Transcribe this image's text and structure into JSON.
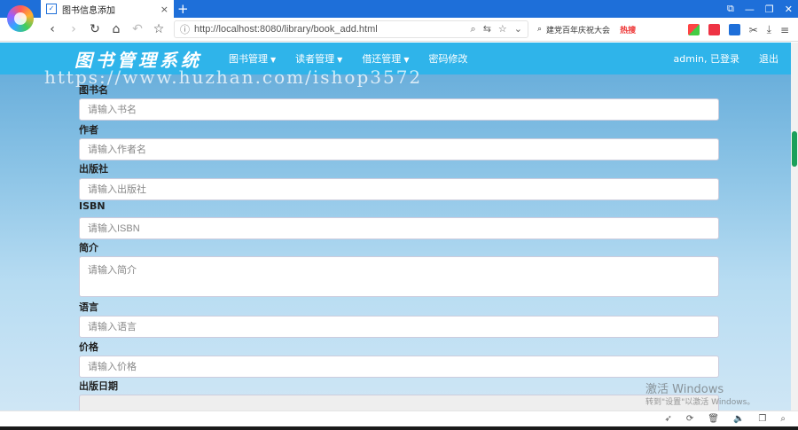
{
  "browser": {
    "tab_title": "图书信息添加",
    "tab_close": "×",
    "new_tab": "+",
    "url": "http://localhost:8080/library/book_add.html",
    "search_text": "建党百年庆祝大会",
    "hot_label": "热搜",
    "window_controls": [
      "⧉",
      "—",
      "❐",
      "✕"
    ]
  },
  "navbar": {
    "brand": "图书管理系统",
    "menu": [
      {
        "label": "图书管理",
        "dropdown": true
      },
      {
        "label": "读者管理",
        "dropdown": true
      },
      {
        "label": "借还管理",
        "dropdown": true
      },
      {
        "label": "密码修改",
        "dropdown": false
      }
    ],
    "user": "admin, 已登录",
    "logout": "退出"
  },
  "watermark": "https://www.huzhan.com/ishop3572",
  "form": {
    "fields": [
      {
        "label": "图书名",
        "placeholder": "请输入书名"
      },
      {
        "label": "作者",
        "placeholder": "请输入作者名"
      },
      {
        "label": "出版社",
        "placeholder": "请输入出版社"
      },
      {
        "label": "ISBN",
        "placeholder": "请输入ISBN"
      },
      {
        "label": "简介",
        "placeholder": "请输入简介"
      },
      {
        "label": "语言",
        "placeholder": "请输入语言"
      },
      {
        "label": "价格",
        "placeholder": "请输入价格"
      },
      {
        "label": "出版日期",
        "placeholder": ""
      }
    ]
  },
  "os_overlay": {
    "activate_title": "激活 Windows",
    "activate_sub": "转到\"设置\"以激活 Windows。"
  }
}
